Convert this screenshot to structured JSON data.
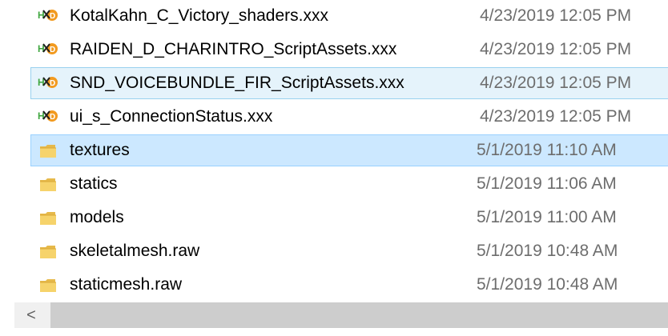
{
  "files": [
    {
      "name": "KotalKahn_C_Victory_shaders.xxx",
      "date": "4/23/2019 12:05 PM",
      "icon": "hxd-file-icon",
      "state": "normal"
    },
    {
      "name": "RAIDEN_D_CHARINTRO_ScriptAssets.xxx",
      "date": "4/23/2019 12:05 PM",
      "icon": "hxd-file-icon",
      "state": "normal"
    },
    {
      "name": "SND_VOICEBUNDLE_FIR_ScriptAssets.xxx",
      "date": "4/23/2019 12:05 PM",
      "icon": "hxd-file-icon",
      "state": "hover"
    },
    {
      "name": "ui_s_ConnectionStatus.xxx",
      "date": "4/23/2019 12:05 PM",
      "icon": "hxd-file-icon",
      "state": "normal"
    },
    {
      "name": "textures",
      "date": "5/1/2019 11:10 AM",
      "icon": "folder-icon",
      "state": "selected"
    },
    {
      "name": "statics",
      "date": "5/1/2019 11:06 AM",
      "icon": "folder-icon",
      "state": "normal"
    },
    {
      "name": "models",
      "date": "5/1/2019 11:00 AM",
      "icon": "folder-icon",
      "state": "normal"
    },
    {
      "name": "skeletalmesh.raw",
      "date": "5/1/2019 10:48 AM",
      "icon": "folder-icon",
      "state": "normal"
    },
    {
      "name": "staticmesh.raw",
      "date": "5/1/2019 10:48 AM",
      "icon": "folder-icon",
      "state": "normal"
    }
  ],
  "scrollbar": {
    "left_arrow_glyph": "<"
  },
  "colors": {
    "hover_bg": "#e5f3fb",
    "hover_border": "#99d1ef",
    "selected_bg": "#cce8ff",
    "selected_border": "#99d1ff",
    "date_text": "#6d6d6d",
    "hxd_green": "#3fa63f",
    "hxd_orange": "#f29a1f",
    "folder_yellow": "#f6d36b"
  }
}
